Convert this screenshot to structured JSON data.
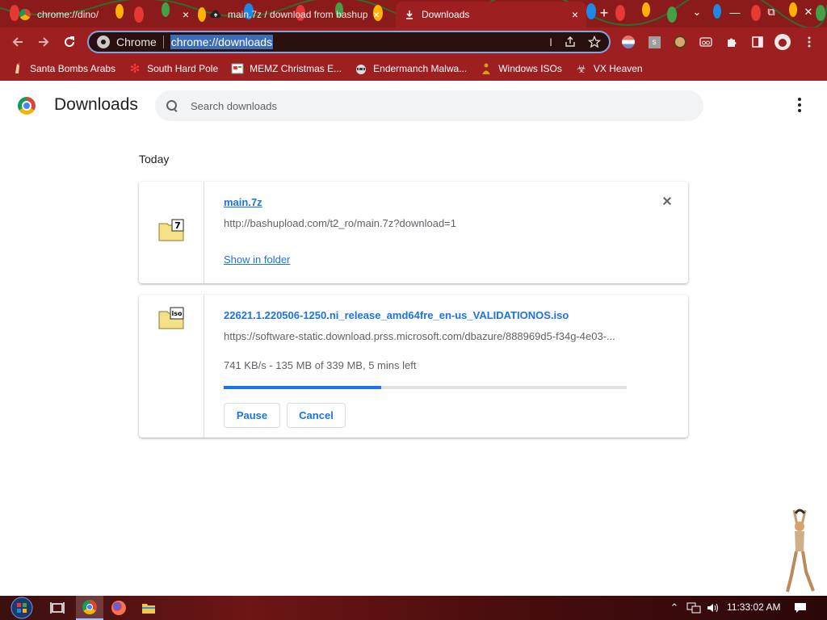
{
  "tabs": [
    {
      "title": "chrome://dino/",
      "icon": "chrome-icon",
      "active": false
    },
    {
      "title": "main.7z / download from bashup",
      "icon": "upload-cloud-icon",
      "active": false
    },
    {
      "title": "Downloads",
      "icon": "download-icon",
      "active": true
    }
  ],
  "tab_close_symbol": "×",
  "new_tab_symbol": "+",
  "window_controls": {
    "tab_search": "⌄",
    "minimize": "—",
    "maximize": "⧉",
    "close": "✕"
  },
  "omnibox": {
    "site_label": "Chrome",
    "url": "chrome://downloads"
  },
  "bookmarks": [
    {
      "label": "Santa Bombs Arabs",
      "icon": "santa-icon"
    },
    {
      "label": "South Hard Pole",
      "icon": "snowflake-icon"
    },
    {
      "label": "MEMZ Christmas E...",
      "icon": "memz-icon"
    },
    {
      "label": "Endermanch Malwa...",
      "icon": "raccoon-icon"
    },
    {
      "label": "Windows ISOs",
      "icon": "buddha-icon"
    },
    {
      "label": "VX Heaven",
      "icon": "biohazard-icon"
    }
  ],
  "page": {
    "title": "Downloads",
    "search_placeholder": "Search downloads",
    "date_heading": "Today"
  },
  "downloads": [
    {
      "file_name": "main.7z",
      "url": "http://bashupload.com/t2_ro/main.7z?download=1",
      "action_link": "Show in folder",
      "icon": "7z-file-icon",
      "icon_badge": "7"
    },
    {
      "file_name": "22621.1.220506-1250.ni_release_amd64fre_en-us_VALIDATIONOS.iso",
      "url": "https://software-static.download.prss.microsoft.com/dbazure/888969d5-f34g-4e03-...",
      "status": "741 KB/s - 135 MB of 339 MB, 5 mins left",
      "progress_fraction": 0.39,
      "pause_label": "Pause",
      "cancel_label": "Cancel",
      "icon": "iso-file-icon",
      "icon_badge": "iso"
    }
  ],
  "taskbar": {
    "clock": "11:33:02 AM"
  },
  "colors": {
    "theme_red": "#9e1f1f",
    "link_blue": "#1a73e8",
    "progress_track": "#e0e0e0"
  }
}
